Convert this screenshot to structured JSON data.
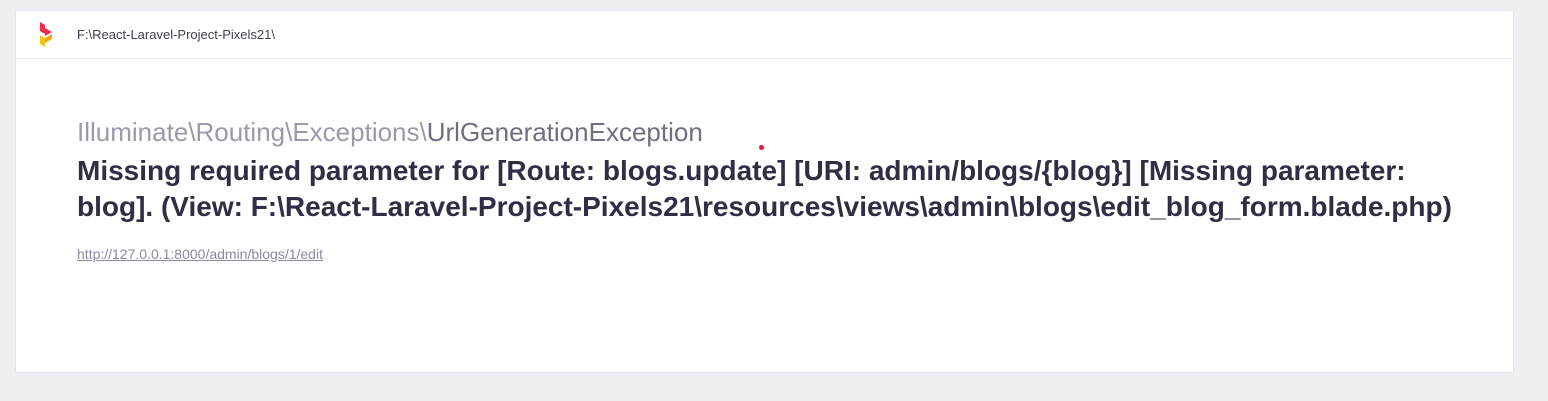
{
  "header": {
    "path": "F:\\React-Laravel-Project-Pixels21\\",
    "logo_icon": "ignition-flame-logo-icon"
  },
  "exception": {
    "namespace": "Illuminate\\Routing\\Exceptions\\",
    "class_name": "UrlGenerationException",
    "message": "Missing required parameter for [Route: blogs.update] [URI: admin/blogs/{blog}] [Missing parameter: blog]. (View: F:\\React-Laravel-Project-Pixels21\\resources\\views\\admin\\blogs\\edit_blog_form.blade.php)",
    "url": "http://127.0.0.1:8000/admin/blogs/1/edit"
  },
  "colors": {
    "page_background": "#eeeff3",
    "card_background": "#ffffff",
    "message_text": "#2e2e45",
    "muted_text": "#9a9aab",
    "logo_red": "#ef2d4a",
    "logo_yellow": "#f6c416"
  }
}
